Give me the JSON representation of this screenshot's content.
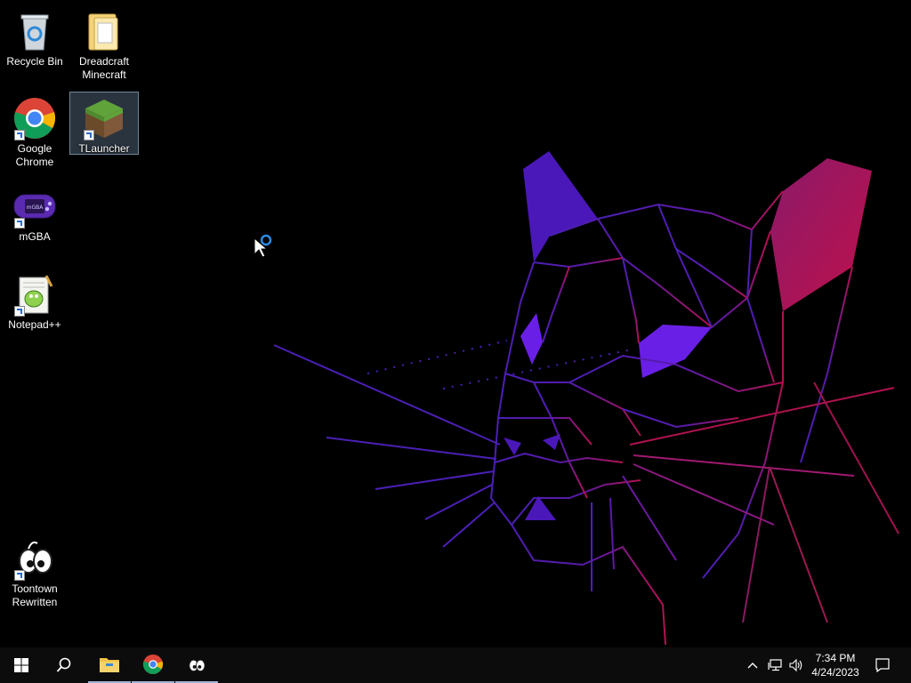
{
  "desktop": {
    "icons": [
      {
        "label": "Recycle Bin",
        "icon": "recycle-bin-icon"
      },
      {
        "label": "Dreadcraft Minecraft",
        "icon": "folder-icon"
      },
      {
        "label": "Google Chrome",
        "icon": "chrome-icon"
      },
      {
        "label": "TLauncher",
        "icon": "minecraft-grass-block-icon"
      },
      {
        "label": "mGBA",
        "icon": "gameboy-advance-icon"
      },
      {
        "label": "Notepad++",
        "icon": "notepad-plus-plus-icon"
      },
      {
        "label": "Toontown Rewritten",
        "icon": "toontown-icon"
      }
    ],
    "wallpaper": "geometric-panther-wallpaper"
  },
  "taskbar": {
    "start": "windows-start-icon",
    "search": "search-icon",
    "pinned": [
      {
        "icon": "file-explorer-icon",
        "running": true
      },
      {
        "icon": "chrome-icon",
        "running": true
      },
      {
        "icon": "toontown-icon",
        "running": true
      }
    ],
    "tray": {
      "chevron": "show-hidden-icons-chevron",
      "network": "network-icon",
      "volume": "volume-icon",
      "notifications": "action-center-icon"
    },
    "clock": {
      "time": "7:34 PM",
      "date": "4/24/2023"
    }
  },
  "colors": {
    "accent_purple": "#6a1fd6",
    "accent_magenta": "#b0124e",
    "taskbar": "#0c0c0c"
  }
}
